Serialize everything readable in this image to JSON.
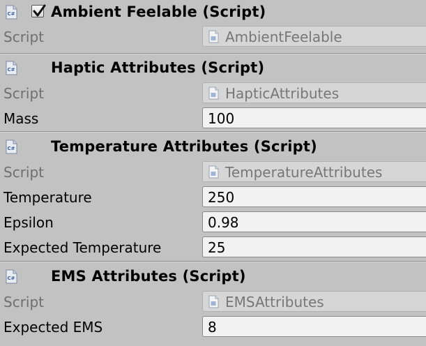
{
  "components": [
    {
      "title": "Ambient Feelable (Script)",
      "enabled": true,
      "has_checkbox": true,
      "script_label": "Script",
      "script_value": "AmbientFeelable",
      "fields": []
    },
    {
      "title": "Haptic Attributes (Script)",
      "has_checkbox": false,
      "script_label": "Script",
      "script_value": "HapticAttributes",
      "fields": [
        {
          "label": "Mass",
          "value": "100"
        }
      ]
    },
    {
      "title": "Temperature Attributes (Script)",
      "has_checkbox": false,
      "script_label": "Script",
      "script_value": "TemperatureAttributes",
      "fields": [
        {
          "label": "Temperature",
          "value": "250"
        },
        {
          "label": "Epsilon",
          "value": "0.98"
        },
        {
          "label": "Expected Temperature",
          "value": "25"
        }
      ]
    },
    {
      "title": "EMS Attributes (Script)",
      "has_checkbox": false,
      "script_label": "Script",
      "script_value": "EMSAttributes",
      "fields": [
        {
          "label": "Expected EMS",
          "value": "8"
        }
      ]
    }
  ],
  "icons": {
    "component_icon": "csharp-script-icon",
    "field_icon": "script-file-icon",
    "checkbox_icon": "checkmark-icon",
    "component_icon_text": "C#"
  },
  "colors": {
    "panel_bg": "#c2c2c2",
    "field_bg": "#f2f2f2",
    "disabled_field_bg": "#d6d6d6",
    "disabled_text": "#6f6f6f"
  }
}
